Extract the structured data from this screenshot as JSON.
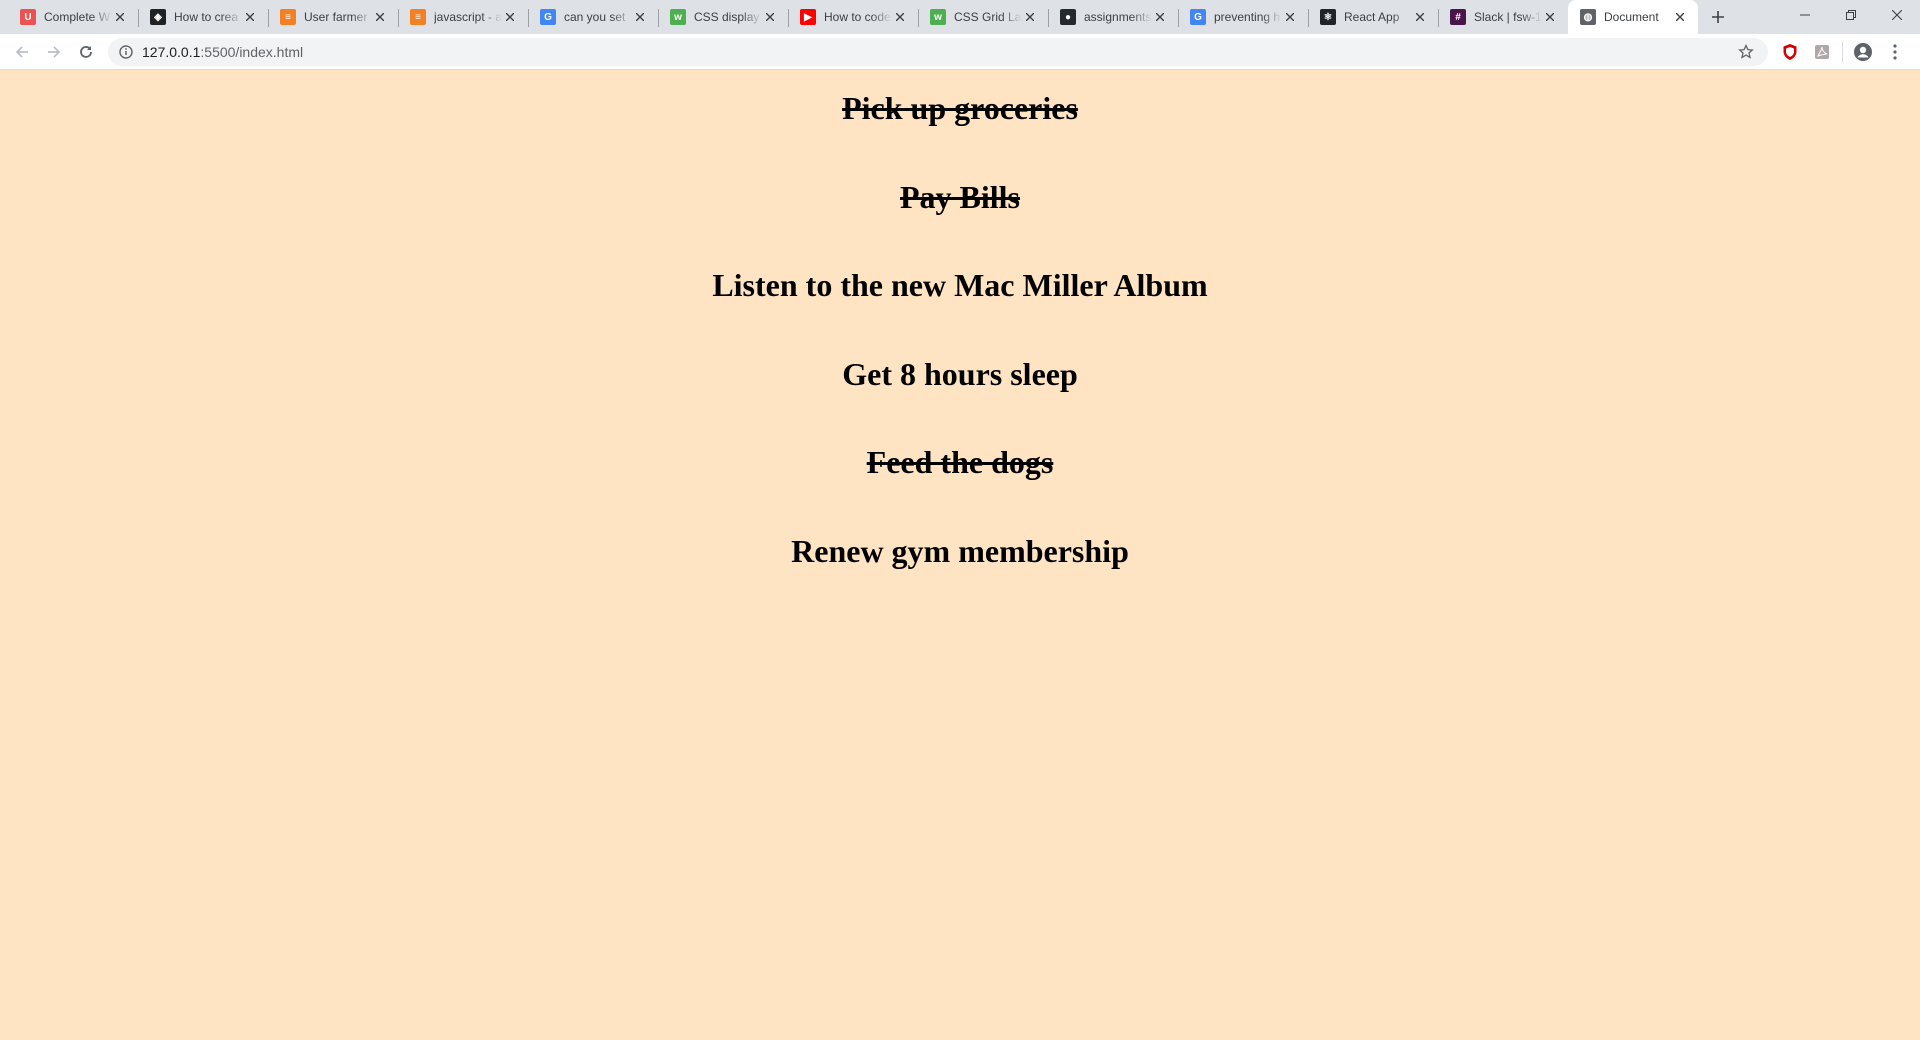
{
  "browser": {
    "tabs": [
      {
        "title": "Complete W",
        "icon": "udemy-icon",
        "color": "#ec5252",
        "glyph": "U",
        "active": false
      },
      {
        "title": "How to crea",
        "icon": "codepen-icon",
        "color": "#202124",
        "glyph": "◈",
        "active": false
      },
      {
        "title": "User farmer",
        "icon": "stackoverflow-icon",
        "color": "#f48024",
        "glyph": "≡",
        "active": false
      },
      {
        "title": "javascript - a",
        "icon": "stackoverflow-icon",
        "color": "#f48024",
        "glyph": "≡",
        "active": false
      },
      {
        "title": "can you set",
        "icon": "google-icon",
        "color": "#4285f4",
        "glyph": "G",
        "active": false
      },
      {
        "title": "CSS display",
        "icon": "w3schools-icon",
        "color": "#4caf50",
        "glyph": "w",
        "active": false
      },
      {
        "title": "How to code",
        "icon": "youtube-icon",
        "color": "#ff0000",
        "glyph": "▶",
        "active": false
      },
      {
        "title": "CSS Grid Lay",
        "icon": "w3schools-icon",
        "color": "#4caf50",
        "glyph": "w",
        "active": false
      },
      {
        "title": "assignments",
        "icon": "github-icon",
        "color": "#24292e",
        "glyph": "●",
        "active": false
      },
      {
        "title": "preventing h",
        "icon": "google-icon",
        "color": "#4285f4",
        "glyph": "G",
        "active": false
      },
      {
        "title": "React App",
        "icon": "react-icon",
        "color": "#20232a",
        "glyph": "⚛",
        "active": false
      },
      {
        "title": "Slack | fsw-1",
        "icon": "slack-icon",
        "color": "#4a154b",
        "glyph": "#",
        "active": false
      },
      {
        "title": "Document",
        "icon": "globe-icon",
        "color": "#5f6368",
        "glyph": "◍",
        "active": true
      }
    ],
    "url": {
      "host": "127.0.0.1",
      "rest": ":5500/index.html"
    }
  },
  "todos": [
    {
      "text": "Pick up groceries",
      "done": true
    },
    {
      "text": "Pay Bills",
      "done": true
    },
    {
      "text": "Listen to the new Mac Miller Album",
      "done": false
    },
    {
      "text": "Get 8 hours sleep",
      "done": false
    },
    {
      "text": "Feed the dogs",
      "done": true
    },
    {
      "text": "Renew gym membership",
      "done": false
    }
  ]
}
